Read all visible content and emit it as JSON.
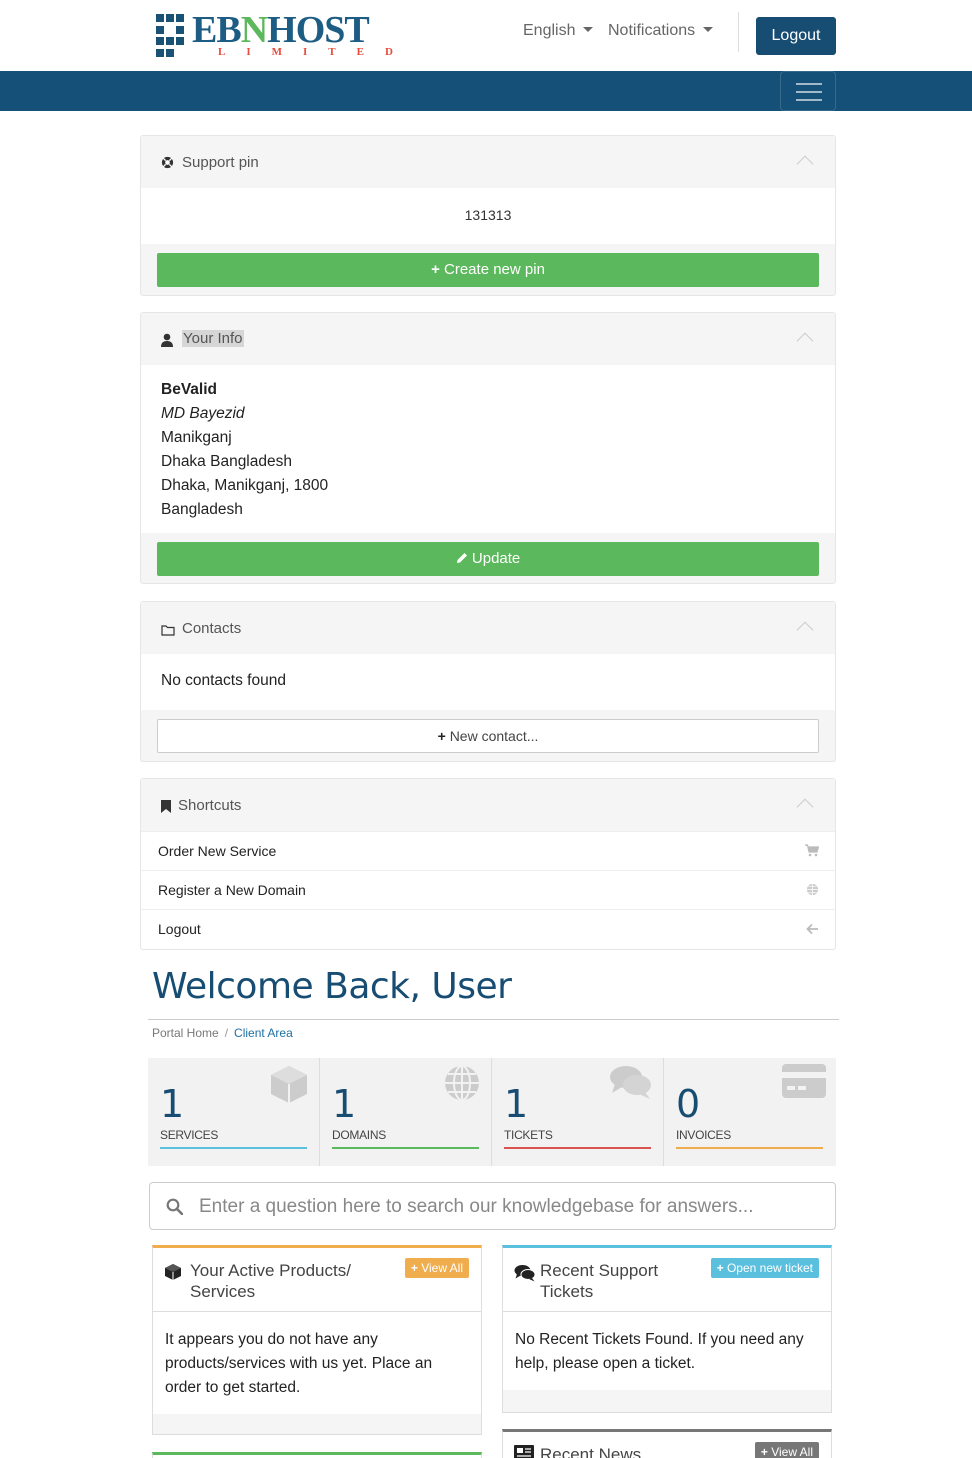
{
  "header": {
    "logo_word_a": "EB",
    "logo_word_n": "N",
    "logo_word_b": "HOST",
    "logo_sub": "LIMITED",
    "language": "English",
    "notifications": "Notifications",
    "logout": "Logout"
  },
  "support_pin": {
    "title": "Support pin",
    "pin": "131313",
    "button": "Create new pin"
  },
  "your_info": {
    "title": "Your Info",
    "company": "BeValid",
    "name": "MD Bayezid",
    "address1": "Manikganj",
    "address2": "Dhaka Bangladesh",
    "city_line": "Dhaka, Manikganj, 1800",
    "country": "Bangladesh",
    "button": "Update"
  },
  "contacts": {
    "title": "Contacts",
    "empty": "No contacts found",
    "button": "New contact..."
  },
  "shortcuts": {
    "title": "Shortcuts",
    "items": [
      {
        "label": "Order New Service",
        "icon": "cart-icon"
      },
      {
        "label": "Register a New Domain",
        "icon": "globe-icon"
      },
      {
        "label": "Logout",
        "icon": "arrow-left-icon"
      }
    ]
  },
  "welcome": {
    "heading": "Welcome Back, User",
    "breadcrumb_home": "Portal Home",
    "breadcrumb_sep": "/",
    "breadcrumb_active": "Client Area"
  },
  "stats": [
    {
      "value": "1",
      "label": "SERVICES",
      "color": "#5bc0de",
      "icon": "cube-icon"
    },
    {
      "value": "1",
      "label": "DOMAINS",
      "color": "#5cb85c",
      "icon": "globe-icon"
    },
    {
      "value": "1",
      "label": "TICKETS",
      "color": "#d9534f",
      "icon": "comments-icon"
    },
    {
      "value": "0",
      "label": "INVOICES",
      "color": "#f0ad4e",
      "icon": "credit-card-icon"
    }
  ],
  "kb_search": {
    "placeholder": "Enter a question here to search our knowledgebase for answers..."
  },
  "panels": {
    "products": {
      "title_line1": "Your Active Products/",
      "title_line2": "Services",
      "tag": "View All",
      "body": "It appears you do not have any products/services with us yet. Place an order to get started.",
      "color": "#f0ad4e"
    },
    "tickets": {
      "title_line1": "Recent Support",
      "title_line2": "Tickets",
      "tag": "Open new ticket",
      "body": "No Recent Tickets Found. If you need any help, please open a ticket.",
      "color": "#5bc0de"
    },
    "news": {
      "title": "Recent News",
      "tag": "View All",
      "color": "#777777"
    }
  }
}
